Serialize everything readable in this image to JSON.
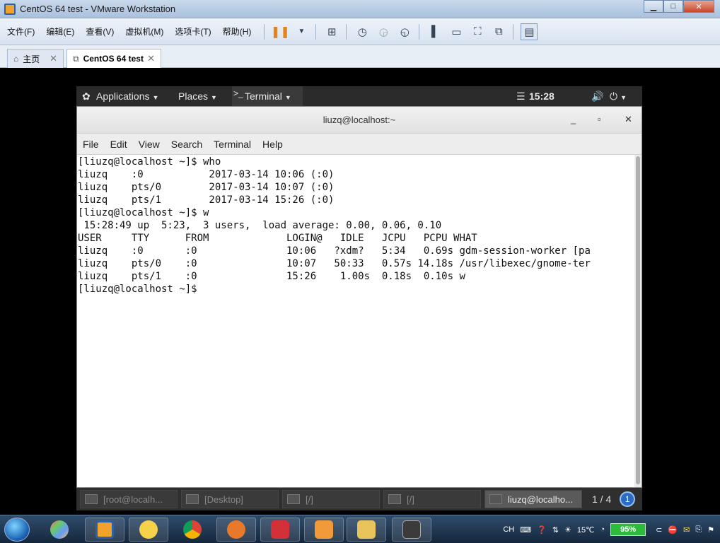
{
  "vmware": {
    "window_title": "CentOS 64 test - VMware Workstation",
    "controls": {
      "minimize": "▁",
      "maximize": "□",
      "close": "✕"
    },
    "menu": [
      "文件(F)",
      "编辑(E)",
      "查看(V)",
      "虚拟机(M)",
      "选项卡(T)",
      "帮助(H)"
    ],
    "toolbar_icons": [
      "pause-icon",
      "dropdown-icon",
      "network-icon",
      "snapshot-icon",
      "snapshot-revert-icon",
      "snapshot-manager-icon",
      "view-library-icon",
      "view-console-icon",
      "fullscreen-icon",
      "unity-icon",
      "thumbnail-icon"
    ],
    "tabs": [
      {
        "label": "主页",
        "icon": "home-icon"
      },
      {
        "label": "CentOS 64 test",
        "icon": "vm-icon",
        "active": true
      }
    ]
  },
  "gnome": {
    "top_bar": {
      "applications": "Applications",
      "places": "Places",
      "active_app": "Terminal",
      "clock": "15:28"
    },
    "terminal": {
      "title": "liuzq@localhost:~",
      "menu": [
        "File",
        "Edit",
        "View",
        "Search",
        "Terminal",
        "Help"
      ],
      "output": "[liuzq@localhost ~]$ who\nliuzq    :0           2017-03-14 10:06 (:0)\nliuzq    pts/0        2017-03-14 10:07 (:0)\nliuzq    pts/1        2017-03-14 15:26 (:0)\n[liuzq@localhost ~]$ w\n 15:28:49 up  5:23,  3 users,  load average: 0.00, 0.06, 0.10\nUSER     TTY      FROM             LOGIN@   IDLE   JCPU   PCPU WHAT\nliuzq    :0       :0               10:06   ?xdm?   5:34   0.69s gdm-session-worker [pa\nliuzq    pts/0    :0               10:07   50:33   0.57s 14.18s /usr/libexec/gnome-ter\nliuzq    pts/1    :0               15:26    1.00s  0.18s  0.10s w\n[liuzq@localhost ~]$"
    },
    "window_list": [
      {
        "label": "[root@localh...",
        "active": false
      },
      {
        "label": "[Desktop]",
        "active": false
      },
      {
        "label": "[/]",
        "active": false
      },
      {
        "label": "[/]",
        "active": false
      },
      {
        "label": "liuzq@localho...",
        "active": true
      }
    ],
    "workspace": "1 / 4",
    "workspace_badge": "1"
  },
  "windows_taskbar": {
    "apps": [
      "explorer-icon",
      "vmware-icon",
      "messenger-icon",
      "chrome-icon",
      "foxmail-icon",
      "xmind-icon",
      "briefcase-icon",
      "folder-icon",
      "sublime-icon"
    ],
    "tray": {
      "ime": "CH",
      "temperature": "15℃",
      "battery": "95%"
    }
  }
}
